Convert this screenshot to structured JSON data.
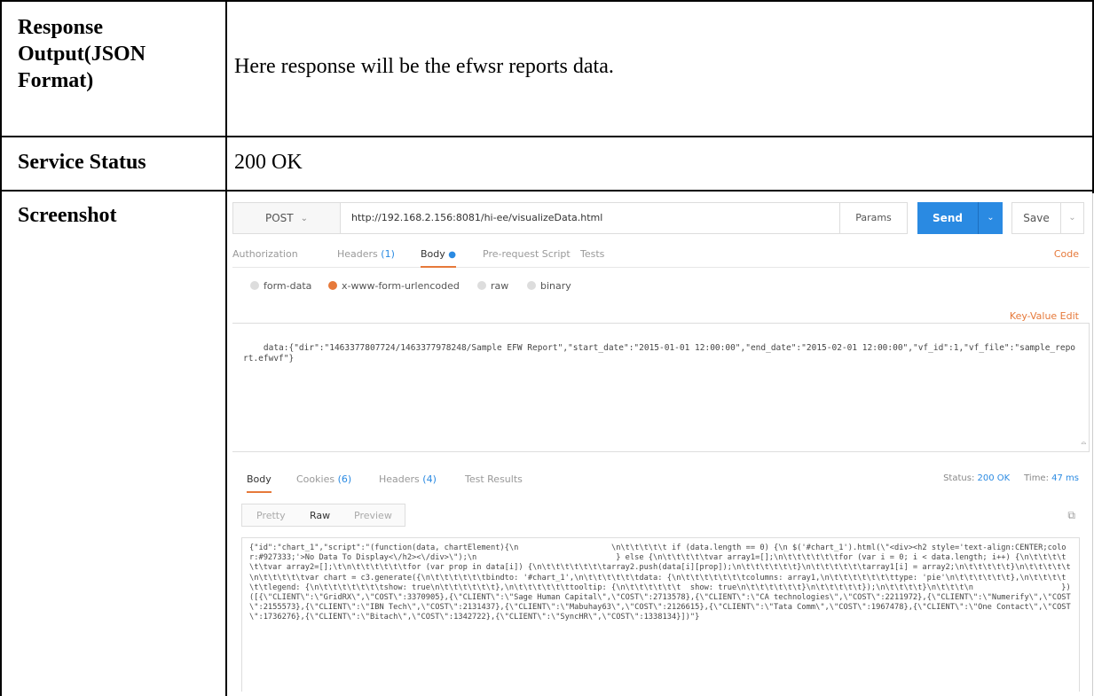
{
  "table": {
    "rows": [
      {
        "label": "Response Output(JSON Format)",
        "value": "Here response will be the efwsr reports data."
      },
      {
        "label": "Service Status",
        "value": "200 OK"
      },
      {
        "label": "Screenshot",
        "value": ""
      }
    ]
  },
  "postman": {
    "method": "POST",
    "url": "http://192.168.2.156:8081/hi-ee/visualizeData.html",
    "params_label": "Params",
    "send_label": "Send",
    "save_label": "Save",
    "request_tabs": {
      "authorization": "Authorization",
      "headers": "Headers",
      "headers_count": "(1)",
      "body": "Body",
      "prerequest": "Pre-request Script",
      "tests": "Tests"
    },
    "code_label": "Code",
    "body_types": [
      "form-data",
      "x-www-form-urlencoded",
      "raw",
      "binary"
    ],
    "selected_body_type": "x-www-form-urlencoded",
    "key_value_edit": "Key-Value Edit",
    "request_body": "data:{\"dir\":\"1463377807724/1463377978248/Sample EFW Report\",\"start_date\":\"2015-01-01 12:00:00\",\"end_date\":\"2015-02-01 12:00:00\",\"vf_id\":1,\"vf_file\":\"sample_report.efwvf\"}",
    "response_tabs": {
      "body": "Body",
      "cookies": "Cookies",
      "cookies_count": "(6)",
      "headers": "Headers",
      "headers_count": "(4)",
      "test_results": "Test Results"
    },
    "status_label": "Status:",
    "status_value": "200 OK",
    "time_label": "Time:",
    "time_value": "47 ms",
    "view_modes": [
      "Pretty",
      "Raw",
      "Preview"
    ],
    "active_view_mode": "Raw",
    "response_body": "{\"id\":\"chart_1\",\"script\":\"(function(data, chartElement){\\n                    \\n\\t\\t\\t\\t\\t if (data.length == 0) {\\n $('#chart_1').html(\\\"<div><h2 style='text-align:CENTER;color:#927333;'>No Data To Display<\\/h2><\\/div>\\\");\\n                              } else {\\n\\t\\t\\t\\t\\tvar array1=[];\\n\\t\\t\\t\\t\\t\\tfor (var i = 0; i < data.length; i++) {\\n\\t\\t\\t\\t\\t\\tvar array2=[];\\t\\n\\t\\t\\t\\t\\t\\tfor (var prop in data[i]) {\\n\\t\\t\\t\\t\\t\\t\\tarray2.push(data[i][prop]);\\n\\t\\t\\t\\t\\t\\t}\\n\\t\\t\\t\\t\\t\\tarray1[i] = array2;\\n\\t\\t\\t\\t\\t}\\n\\t\\t\\t\\t\\t\\n\\t\\t\\t\\t\\tvar chart = c3.generate({\\n\\t\\t\\t\\t\\t\\tbindto: '#chart_1',\\n\\t\\t\\t\\t\\t\\tdata: {\\n\\t\\t\\t\\t\\t\\t\\tcolumns: array1,\\n\\t\\t\\t\\t\\t\\t\\ttype: 'pie'\\n\\t\\t\\t\\t\\t\\t},\\n\\t\\t\\t\\t\\t\\tlegend: {\\n\\t\\t\\t\\t\\t\\t\\tshow: true\\n\\t\\t\\t\\t\\t\\t},\\n\\t\\t\\t\\t\\t\\ttooltip: {\\n\\t\\t\\t\\t\\t\\t  show: true\\n\\t\\t\\t\\t\\t\\t}\\n\\t\\t\\t\\t\\t});\\n\\t\\t\\t\\t}\\n\\t\\t\\t\\n                   })([{\\\"CLIENT\\\":\\\"GridRX\\\",\\\"COST\\\":3370905},{\\\"CLIENT\\\":\\\"Sage Human Capital\\\",\\\"COST\\\":2713578},{\\\"CLIENT\\\":\\\"CA technologies\\\",\\\"COST\\\":2211972},{\\\"CLIENT\\\":\\\"Numerify\\\",\\\"COST\\\":2155573},{\\\"CLIENT\\\":\\\"IBN Tech\\\",\\\"COST\\\":2131437},{\\\"CLIENT\\\":\\\"Mabuhay63\\\",\\\"COST\\\":2126615},{\\\"CLIENT\\\":\\\"Tata Comm\\\",\\\"COST\\\":1967478},{\\\"CLIENT\\\":\\\"One Contact\\\",\\\"COST\\\":1736276},{\\\"CLIENT\\\":\\\"Bitach\\\",\\\"COST\\\":1342722},{\\\"CLIENT\\\":\\\"SyncHR\\\",\\\"COST\\\":1338134}])\"}",
    "icons": {
      "method_dropdown": "chevron-down-icon",
      "send_dropdown": "chevron-down-icon",
      "save_dropdown": "chevron-down-icon",
      "copy": "copy-icon",
      "resize": "resize-handle-icon"
    },
    "colors": {
      "accent_orange": "#e6793a",
      "accent_blue": "#2a8ae2"
    }
  }
}
